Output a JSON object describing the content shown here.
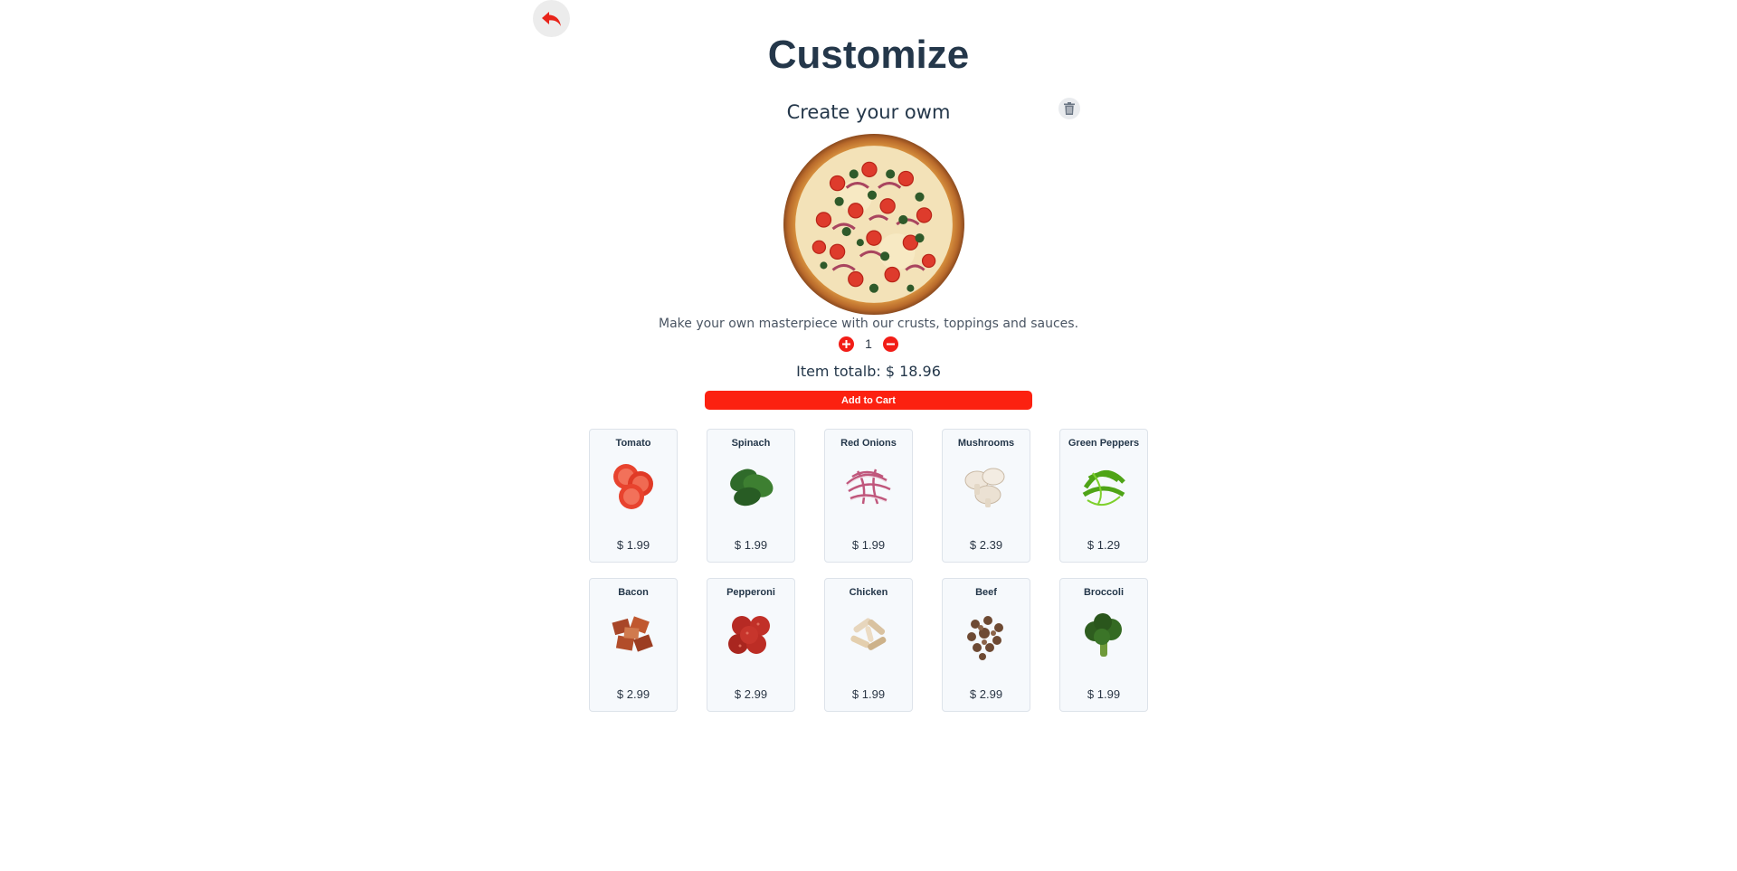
{
  "header": {
    "back_icon": "undo-arrow-icon",
    "title": "Customize"
  },
  "item": {
    "name": "Create your owm",
    "description": "Make your own masterpiece with our crusts, toppings and sauces.",
    "quantity": "1",
    "total": "Item totalb: $ 18.96",
    "add_to_cart_label": "Add to Cart"
  },
  "colors": {
    "accent": "#fc2110",
    "title": "#24374a",
    "card_bg": "#f6f9fc"
  },
  "toppings": [
    {
      "name": "Tomato",
      "price": "$ 1.99"
    },
    {
      "name": "Spinach",
      "price": "$ 1.99"
    },
    {
      "name": "Red Onions",
      "price": "$ 1.99"
    },
    {
      "name": "Mushrooms",
      "price": "$ 2.39"
    },
    {
      "name": "Green Peppers",
      "price": "$ 1.29"
    },
    {
      "name": "Bacon",
      "price": "$ 2.99"
    },
    {
      "name": "Pepperoni",
      "price": "$ 2.99"
    },
    {
      "name": "Chicken",
      "price": "$ 1.99"
    },
    {
      "name": "Beef",
      "price": "$ 2.99"
    },
    {
      "name": "Broccoli",
      "price": "$ 1.99"
    }
  ]
}
